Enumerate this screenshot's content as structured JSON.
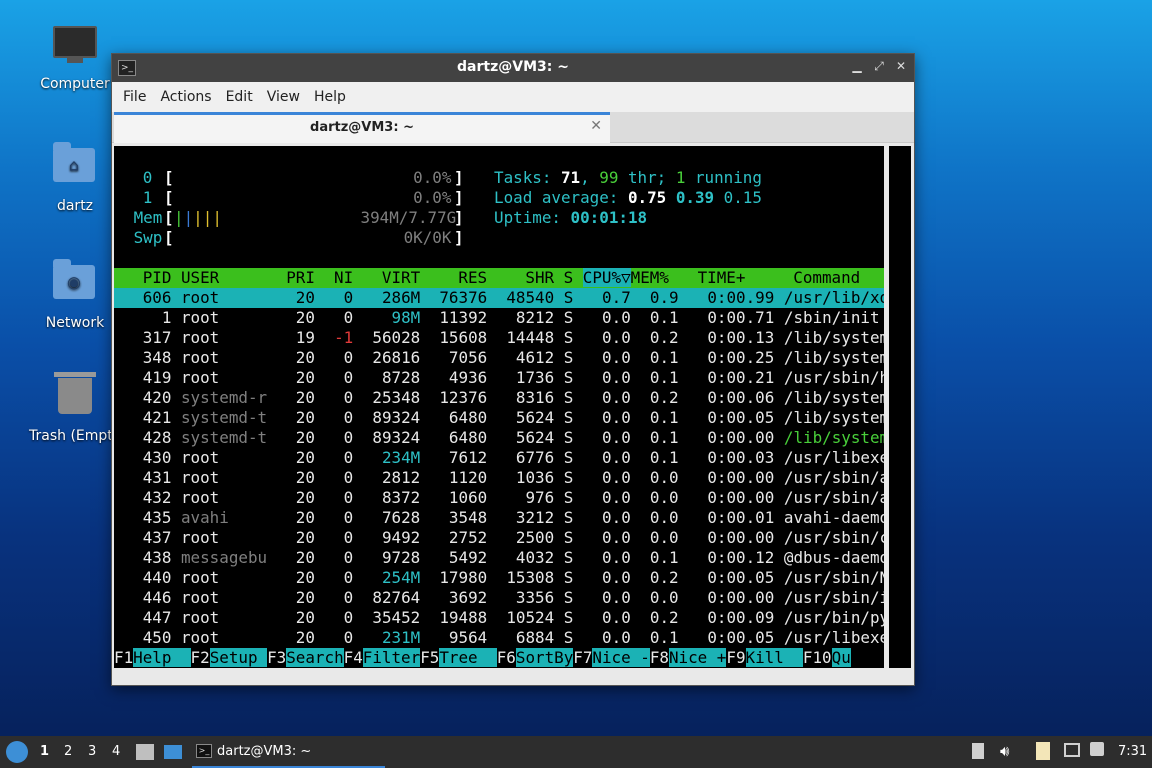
{
  "desktop": {
    "icons": [
      {
        "label": "Computer",
        "icon": "computer-icon"
      },
      {
        "label": "dartz",
        "icon": "home-folder-icon"
      },
      {
        "label": "Network",
        "icon": "network-folder-icon"
      },
      {
        "label": "Trash (Empty)",
        "icon": "trash-icon"
      }
    ]
  },
  "window": {
    "title": "dartz@VM3: ~",
    "menu": [
      "File",
      "Actions",
      "Edit",
      "View",
      "Help"
    ],
    "tab_label": "dartz@VM3: ~"
  },
  "htop": {
    "cpu": [
      {
        "num": "0",
        "value": "0.0%"
      },
      {
        "num": "1",
        "value": "0.0%"
      }
    ],
    "mem_label": "Mem",
    "mem_value": "394M/7.77G",
    "swp_label": "Swp",
    "swp_value": "0K/0K",
    "tasks": {
      "count": "71",
      "thr": "99",
      "running": "1"
    },
    "load": {
      "one": "0.75",
      "five": "0.39",
      "fifteen": "0.15"
    },
    "uptime": "00:01:18",
    "columns": [
      "PID",
      "USER",
      "PRI",
      "NI",
      "VIRT",
      "RES",
      "SHR",
      "S",
      "CPU%▽",
      "MEM%",
      "TIME+",
      "Command"
    ],
    "rows": [
      {
        "pid": "606",
        "user": "root",
        "pri": "20",
        "ni": "0",
        "virt": "286M",
        "res": "76376",
        "shr": "48540",
        "s": "S",
        "cpu": "0.7",
        "mem": "0.9",
        "time": "0:00.99",
        "cmd": "/usr/lib/xor"
      },
      {
        "pid": "1",
        "user": "root",
        "pri": "20",
        "ni": "0",
        "virt": "98M",
        "res": "11392",
        "shr": "8212",
        "s": "S",
        "cpu": "0.0",
        "mem": "0.1",
        "time": "0:00.71",
        "cmd": "/sbin/init s"
      },
      {
        "pid": "317",
        "user": "root",
        "pri": "19",
        "ni": "-1",
        "virt": "56028",
        "res": "15608",
        "shr": "14448",
        "s": "S",
        "cpu": "0.0",
        "mem": "0.2",
        "time": "0:00.13",
        "cmd": "/lib/systemd"
      },
      {
        "pid": "348",
        "user": "root",
        "pri": "20",
        "ni": "0",
        "virt": "26816",
        "res": "7056",
        "shr": "4612",
        "s": "S",
        "cpu": "0.0",
        "mem": "0.1",
        "time": "0:00.25",
        "cmd": "/lib/systemd"
      },
      {
        "pid": "419",
        "user": "root",
        "pri": "20",
        "ni": "0",
        "virt": "8728",
        "res": "4936",
        "shr": "1736",
        "s": "S",
        "cpu": "0.0",
        "mem": "0.1",
        "time": "0:00.21",
        "cmd": "/usr/sbin/ha"
      },
      {
        "pid": "420",
        "user": "systemd-r",
        "pri": "20",
        "ni": "0",
        "virt": "25348",
        "res": "12376",
        "shr": "8316",
        "s": "S",
        "cpu": "0.0",
        "mem": "0.2",
        "time": "0:00.06",
        "cmd": "/lib/systemd"
      },
      {
        "pid": "421",
        "user": "systemd-t",
        "pri": "20",
        "ni": "0",
        "virt": "89324",
        "res": "6480",
        "shr": "5624",
        "s": "S",
        "cpu": "0.0",
        "mem": "0.1",
        "time": "0:00.05",
        "cmd": "/lib/systemd"
      },
      {
        "pid": "428",
        "user": "systemd-t",
        "pri": "20",
        "ni": "0",
        "virt": "89324",
        "res": "6480",
        "shr": "5624",
        "s": "S",
        "cpu": "0.0",
        "mem": "0.1",
        "time": "0:00.00",
        "cmd": "/lib/systemd"
      },
      {
        "pid": "430",
        "user": "root",
        "pri": "20",
        "ni": "0",
        "virt": "234M",
        "res": "7612",
        "shr": "6776",
        "s": "S",
        "cpu": "0.0",
        "mem": "0.1",
        "time": "0:00.03",
        "cmd": "/usr/libexec"
      },
      {
        "pid": "431",
        "user": "root",
        "pri": "20",
        "ni": "0",
        "virt": "2812",
        "res": "1120",
        "shr": "1036",
        "s": "S",
        "cpu": "0.0",
        "mem": "0.0",
        "time": "0:00.00",
        "cmd": "/usr/sbin/ac"
      },
      {
        "pid": "432",
        "user": "root",
        "pri": "20",
        "ni": "0",
        "virt": "8372",
        "res": "1060",
        "shr": "976",
        "s": "S",
        "cpu": "0.0",
        "mem": "0.0",
        "time": "0:00.00",
        "cmd": "/usr/sbin/an"
      },
      {
        "pid": "435",
        "user": "avahi",
        "pri": "20",
        "ni": "0",
        "virt": "7628",
        "res": "3548",
        "shr": "3212",
        "s": "S",
        "cpu": "0.0",
        "mem": "0.0",
        "time": "0:00.01",
        "cmd": "avahi-daemon"
      },
      {
        "pid": "437",
        "user": "root",
        "pri": "20",
        "ni": "0",
        "virt": "9492",
        "res": "2752",
        "shr": "2500",
        "s": "S",
        "cpu": "0.0",
        "mem": "0.0",
        "time": "0:00.00",
        "cmd": "/usr/sbin/cr"
      },
      {
        "pid": "438",
        "user": "messagebu",
        "pri": "20",
        "ni": "0",
        "virt": "9728",
        "res": "5492",
        "shr": "4032",
        "s": "S",
        "cpu": "0.0",
        "mem": "0.1",
        "time": "0:00.12",
        "cmd": "@dbus-daemon"
      },
      {
        "pid": "440",
        "user": "root",
        "pri": "20",
        "ni": "0",
        "virt": "254M",
        "res": "17980",
        "shr": "15308",
        "s": "S",
        "cpu": "0.0",
        "mem": "0.2",
        "time": "0:00.05",
        "cmd": "/usr/sbin/Ne"
      },
      {
        "pid": "446",
        "user": "root",
        "pri": "20",
        "ni": "0",
        "virt": "82764",
        "res": "3692",
        "shr": "3356",
        "s": "S",
        "cpu": "0.0",
        "mem": "0.0",
        "time": "0:00.00",
        "cmd": "/usr/sbin/ir"
      },
      {
        "pid": "447",
        "user": "root",
        "pri": "20",
        "ni": "0",
        "virt": "35452",
        "res": "19488",
        "shr": "10524",
        "s": "S",
        "cpu": "0.0",
        "mem": "0.2",
        "time": "0:00.09",
        "cmd": "/usr/bin/pyt"
      },
      {
        "pid": "450",
        "user": "root",
        "pri": "20",
        "ni": "0",
        "virt": "231M",
        "res": "9564",
        "shr": "6884",
        "s": "S",
        "cpu": "0.0",
        "mem": "0.1",
        "time": "0:00.05",
        "cmd": "/usr/libexec"
      }
    ],
    "fkeys": [
      {
        "key": "F1",
        "label": "Help  "
      },
      {
        "key": "F2",
        "label": "Setup "
      },
      {
        "key": "F3",
        "label": "Search"
      },
      {
        "key": "F4",
        "label": "Filter"
      },
      {
        "key": "F5",
        "label": "Tree  "
      },
      {
        "key": "F6",
        "label": "SortBy"
      },
      {
        "key": "F7",
        "label": "Nice -"
      },
      {
        "key": "F8",
        "label": "Nice +"
      },
      {
        "key": "F9",
        "label": "Kill  "
      },
      {
        "key": "F10",
        "label": "Qu"
      }
    ]
  },
  "taskbar": {
    "workspaces": [
      "1",
      "2",
      "3",
      "4"
    ],
    "active_task": "dartz@VM3: ~",
    "clock": "7:31"
  },
  "colors": {
    "cyan": "#2ec0c6",
    "green": "#49cf3a",
    "header_bar": "#3bbf1d",
    "selection": "#1bb2b5"
  }
}
